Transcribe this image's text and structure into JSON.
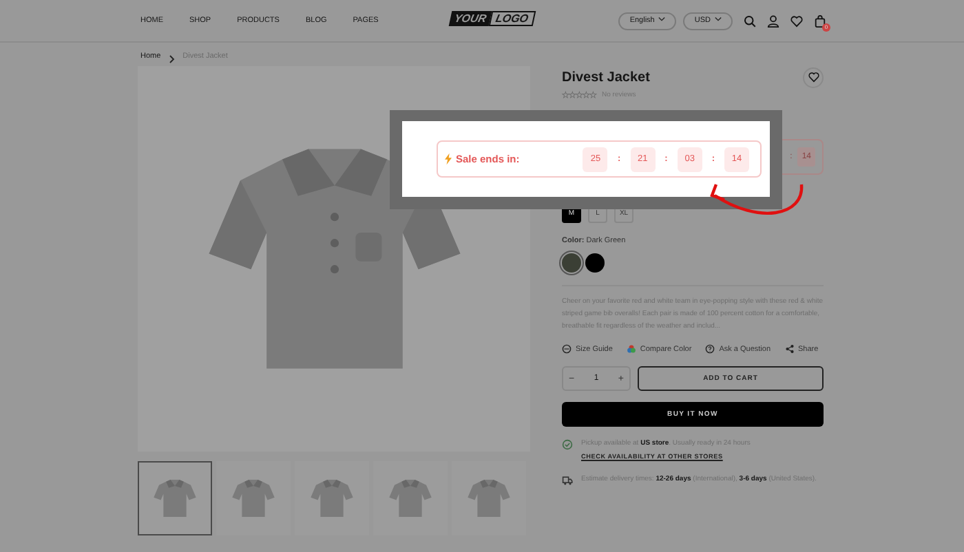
{
  "header": {
    "nav": [
      "HOME",
      "SHOP",
      "PRODUCTS",
      "BLOG",
      "PAGES"
    ],
    "logo": [
      "YOUR",
      "LOGO"
    ],
    "language": "English",
    "currency": "USD",
    "cart_count": "0"
  },
  "breadcrumb": [
    "Home",
    "Divest Jacket"
  ],
  "gallery": {
    "thumbnails": [
      {
        "selected": true
      },
      {
        "selected": false
      },
      {
        "selected": false
      },
      {
        "selected": false
      },
      {
        "selected": false
      }
    ]
  },
  "product": {
    "title": "Divest Jacket",
    "stars": 0,
    "reviews": "No reviews",
    "countdown_behind": {
      "separator": ":",
      "value": "14"
    },
    "sizes": [
      {
        "label": "M",
        "selected": true
      },
      {
        "label": "L",
        "selected": false
      },
      {
        "label": "XL",
        "selected": false
      }
    ],
    "color_label": "**Color:** Dark Green",
    "swatches": [
      {
        "color": "#3b3f35",
        "selected": true
      },
      {
        "color": "#000000",
        "selected": false
      }
    ],
    "description": "Cheer on your favorite red and white team in eye-popping style with these red & white striped game bib overalls! Each pair is made of 100 percent cotton for a comfortable, breathable fit regardless of the weather and includ...",
    "actions": [
      {
        "kind": "size",
        "label": "Size Guide"
      },
      {
        "kind": "compare",
        "label": "Compare Color"
      },
      {
        "kind": "ask",
        "label": "Ask a Question"
      },
      {
        "kind": "share",
        "label": "Share"
      }
    ],
    "quantity": {
      "minus": "−",
      "value": "1",
      "plus": "+"
    },
    "add_to_cart": "ADD TO CART",
    "buy_now": "BUY IT NOW",
    "pickup": "Pickup available at **US store**. Usually ready in 24 hours",
    "pickup_link": "CHECK AVAILABILITY AT OTHER STORES",
    "delivery": "Estimate delivery times: **12-26 days** (International), **3-6 days** (United States)."
  },
  "popup": {
    "label": "Sale ends in:",
    "values": [
      "25",
      "21",
      "03",
      "14"
    ],
    "separator": ":"
  }
}
